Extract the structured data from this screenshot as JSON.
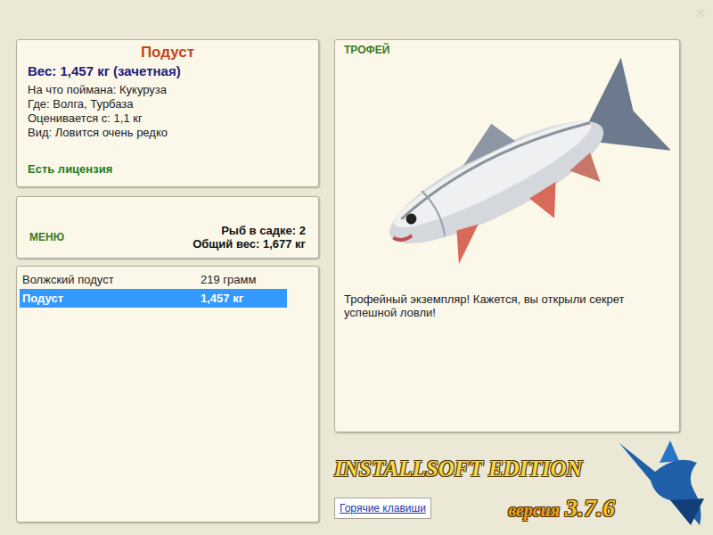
{
  "window": {
    "close": "×"
  },
  "fish": {
    "name": "Подуст",
    "weight": "Вес: 1,457 кг (зачетная)",
    "details": [
      "На что поймана: Кукуруза",
      "Где: Волга, Турбаза",
      "Оценивается с: 1,1 кг",
      "Вид: Ловится очень редко"
    ],
    "license": "Есть лицензия"
  },
  "menu": {
    "label": "МЕНЮ",
    "count": "Рыб в садке: 2",
    "total": "Общий вес: 1,677 кг"
  },
  "catch_list": [
    {
      "name": "Волжский подуст",
      "weight": "219 грамм",
      "selected": false
    },
    {
      "name": "Подуст",
      "weight": "1,457 кг",
      "selected": true
    }
  ],
  "trophy": {
    "label": "ТРОФЕЙ",
    "message": "Трофейный экземпляр! Кажется, вы открыли секрет успешной ловли!"
  },
  "logo": {
    "title": "INSTALLSOFT EDITION",
    "version_label": "версия",
    "version": "3.7.6"
  },
  "buttons": [
    "Горячие клавиши"
  ]
}
